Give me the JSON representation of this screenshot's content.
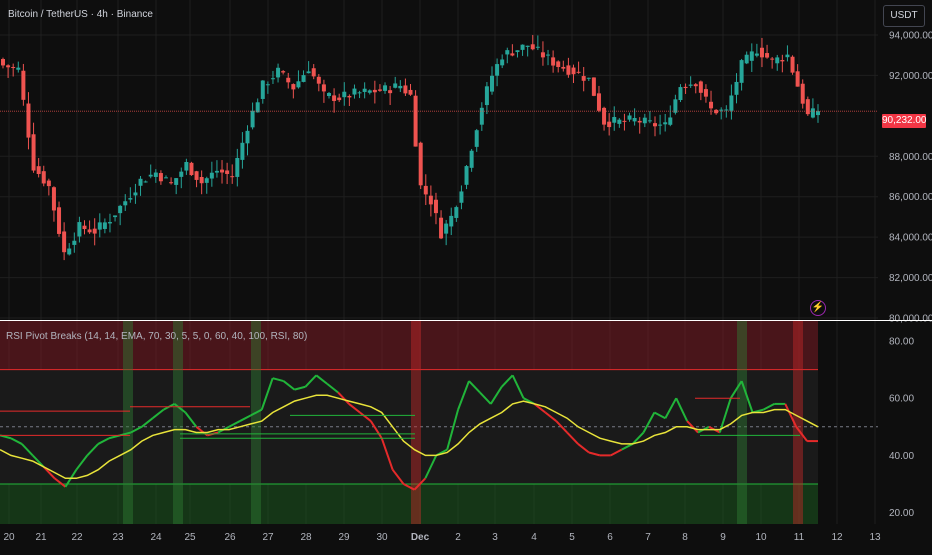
{
  "chart_header": {
    "title": "Bitcoin / TetherUS · 4h · Binance",
    "currency": "USDT",
    "last_price_label": "90,232.00"
  },
  "indicator": {
    "title": "RSI Pivot Breaks (14, 14, EMA, 70, 30, 5, 5, 0, 60, 40, 100, RSI, 80)"
  },
  "colors": {
    "up": "#26a69a",
    "down": "#ef5350",
    "rsi_up": "#21b53a",
    "rsi_down": "#e52a2a",
    "ema": "#e8e33a",
    "upper_zone": "#7a1c24",
    "lower_zone": "#1b5e20",
    "background": "#0e0e0e",
    "grid": "#1f1f1f"
  },
  "chart_data": [
    {
      "type": "candlestick",
      "title": "Bitcoin / TetherUS · 4h · Binance",
      "y_ticks": [
        "94,000.00",
        "92,000.00",
        "88,000.00",
        "86,000.00",
        "84,000.00",
        "82,000.00",
        "80,000.00"
      ],
      "ylim": [
        80000,
        95500
      ],
      "last_price": 90232,
      "x_ticks": [
        "20",
        "21",
        "22",
        "23",
        "24",
        "25",
        "26",
        "27",
        "28",
        "29",
        "30",
        "Dec",
        "2",
        "3",
        "4",
        "5",
        "6",
        "7",
        "8",
        "9",
        "10",
        "11",
        "12",
        "13"
      ],
      "candles_keypoints": [
        {
          "i": 0,
          "c": 92500
        },
        {
          "i": 3,
          "c": 92300
        },
        {
          "i": 6,
          "c": 87500
        },
        {
          "i": 9,
          "c": 86500
        },
        {
          "i": 12,
          "c": 83200
        },
        {
          "i": 15,
          "c": 84500
        },
        {
          "i": 18,
          "c": 84300
        },
        {
          "i": 21,
          "c": 84900
        },
        {
          "i": 24,
          "c": 85800
        },
        {
          "i": 27,
          "c": 86800
        },
        {
          "i": 30,
          "c": 87200
        },
        {
          "i": 33,
          "c": 86600
        },
        {
          "i": 36,
          "c": 87600
        },
        {
          "i": 39,
          "c": 86700
        },
        {
          "i": 42,
          "c": 87300
        },
        {
          "i": 45,
          "c": 87000
        },
        {
          "i": 48,
          "c": 89500
        },
        {
          "i": 51,
          "c": 91500
        },
        {
          "i": 54,
          "c": 92200
        },
        {
          "i": 57,
          "c": 91400
        },
        {
          "i": 60,
          "c": 92400
        },
        {
          "i": 63,
          "c": 91000
        },
        {
          "i": 66,
          "c": 90900
        },
        {
          "i": 69,
          "c": 91100
        },
        {
          "i": 72,
          "c": 91200
        },
        {
          "i": 75,
          "c": 91300
        },
        {
          "i": 78,
          "c": 91500
        },
        {
          "i": 80,
          "c": 91000
        },
        {
          "i": 82,
          "c": 86500
        },
        {
          "i": 84,
          "c": 85800
        },
        {
          "i": 86,
          "c": 84200
        },
        {
          "i": 88,
          "c": 85000
        },
        {
          "i": 90,
          "c": 86500
        },
        {
          "i": 92,
          "c": 88500
        },
        {
          "i": 94,
          "c": 90500
        },
        {
          "i": 96,
          "c": 92000
        },
        {
          "i": 98,
          "c": 93000
        },
        {
          "i": 100,
          "c": 93200
        },
        {
          "i": 103,
          "c": 93500
        },
        {
          "i": 106,
          "c": 93000
        },
        {
          "i": 109,
          "c": 92500
        },
        {
          "i": 112,
          "c": 92200
        },
        {
          "i": 115,
          "c": 91800
        },
        {
          "i": 118,
          "c": 89700
        },
        {
          "i": 121,
          "c": 89700
        },
        {
          "i": 124,
          "c": 89800
        },
        {
          "i": 127,
          "c": 89600
        },
        {
          "i": 130,
          "c": 89500
        },
        {
          "i": 133,
          "c": 91500
        },
        {
          "i": 136,
          "c": 91700
        },
        {
          "i": 139,
          "c": 90300
        },
        {
          "i": 142,
          "c": 90200
        },
        {
          "i": 145,
          "c": 92500
        },
        {
          "i": 148,
          "c": 93300
        },
        {
          "i": 151,
          "c": 92700
        },
        {
          "i": 154,
          "c": 93000
        },
        {
          "i": 156,
          "c": 91500
        },
        {
          "i": 158,
          "c": 90000
        },
        {
          "i": 160,
          "c": 90232
        }
      ]
    },
    {
      "type": "line",
      "title": "RSI Pivot Breaks (14, 14, EMA, 70, 30, 5, 5, 0, 60, 40, 100, RSI, 80)",
      "y_ticks": [
        "80.00",
        "60.00",
        "40.00",
        "20.00"
      ],
      "ylim": [
        16,
        87
      ],
      "upper_band": 70,
      "lower_band": 30,
      "mid_line": 50,
      "series": [
        {
          "values": [
            47,
            46,
            44,
            40,
            36,
            32,
            29,
            35,
            40,
            44,
            46,
            47,
            48,
            50,
            53,
            56,
            58,
            55,
            50,
            47,
            48,
            50,
            52,
            54,
            56,
            67,
            66,
            63,
            64,
            68,
            65,
            62,
            58,
            55,
            52,
            46,
            35,
            30,
            28,
            32,
            40,
            42,
            56,
            66,
            62,
            58,
            64,
            68,
            60,
            58,
            55,
            52,
            48,
            44,
            41,
            40,
            40,
            42,
            44,
            48,
            55,
            53,
            60,
            52,
            48,
            50,
            48,
            60,
            66,
            55,
            56,
            58,
            58,
            50,
            45,
            45
          ],
          "color_rule": "green above previous pivot break, red otherwise"
        },
        {
          "values": [
            42,
            40,
            39,
            38,
            36,
            34,
            32,
            32,
            33,
            35,
            38,
            40,
            42,
            45,
            47,
            48,
            49,
            49,
            48,
            48,
            49,
            49,
            50,
            51,
            52,
            55,
            57,
            59,
            60,
            61,
            61,
            60,
            59,
            58,
            57,
            55,
            50,
            45,
            42,
            40,
            40,
            41,
            44,
            48,
            51,
            53,
            55,
            58,
            59,
            58,
            57,
            55,
            53,
            50,
            48,
            46,
            45,
            44,
            44,
            45,
            47,
            48,
            50,
            50,
            49,
            49,
            49,
            51,
            54,
            55,
            55,
            56,
            56,
            54,
            52,
            50
          ],
          "color": "#e8e33a"
        }
      ]
    }
  ]
}
